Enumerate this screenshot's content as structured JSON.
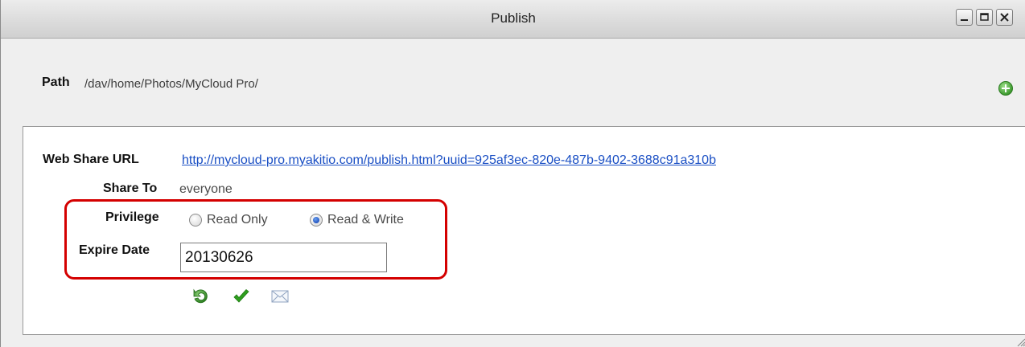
{
  "window": {
    "title": "Publish",
    "controls": [
      "minimize-icon",
      "maximize-icon",
      "close-icon"
    ]
  },
  "path": {
    "label": "Path",
    "value": "/dav/home/Photos/MyCloud Pro/",
    "add_icon": "add-circle-icon"
  },
  "share": {
    "url_label": "Web Share URL",
    "url": "http://mycloud-pro.myakitio.com/publish.html?uuid=925af3ec-820e-487b-9402-3688c91a310b",
    "share_to_label": "Share To",
    "share_to_value": "everyone",
    "privilege_label": "Privilege",
    "privilege_options": [
      {
        "label": "Read Only",
        "selected": false
      },
      {
        "label": "Read & Write",
        "selected": true
      }
    ],
    "expire_label": "Expire Date",
    "expire_value": "20130626"
  },
  "actions": [
    "refresh-icon",
    "confirm-check-icon",
    "email-icon"
  ],
  "colors": {
    "link": "#1a4fc4",
    "highlight": "#d40000",
    "add_icon": "#3aa62e",
    "check": "#2e9e1e"
  }
}
